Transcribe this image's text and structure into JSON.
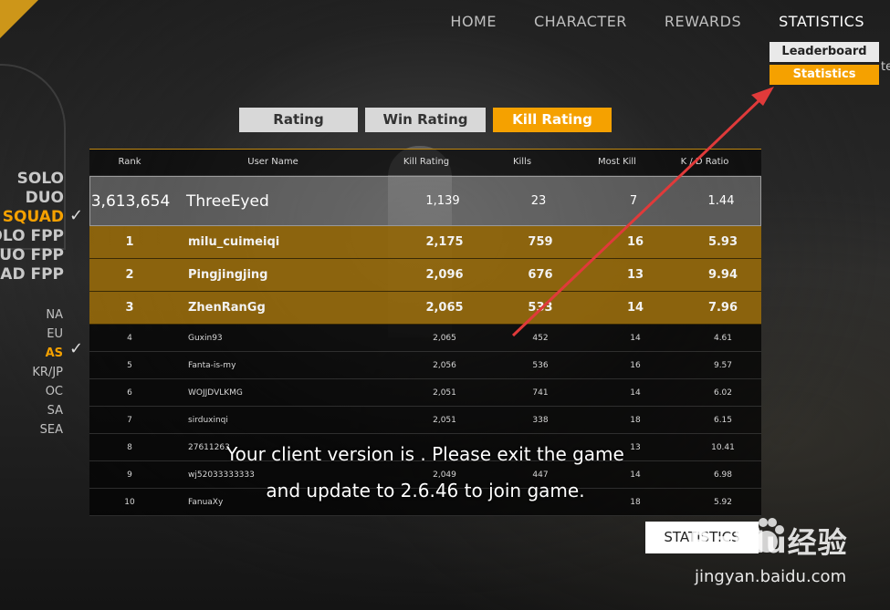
{
  "nav": {
    "items": [
      "HOME",
      "CHARACTER",
      "REWARDS",
      "STATISTICS"
    ],
    "active": "STATISTICS"
  },
  "dropdown": {
    "items": [
      "Leaderboard",
      "Statistics"
    ],
    "active": "Statistics",
    "overflow_text": "te"
  },
  "tabs": {
    "items": [
      "Rating",
      "Win Rating",
      "Kill Rating"
    ],
    "active": "Kill Rating"
  },
  "modes": [
    "SOLO",
    "DUO",
    "SQUAD",
    "SOLO FPP",
    "DUO FPP",
    "SQUAD FPP"
  ],
  "mode_visible": [
    "SOLO",
    "DUO",
    "SQUAD",
    "SOLO FPP",
    "DUO FPP",
    "UAD FPP"
  ],
  "active_mode": "SQUAD",
  "regions": [
    "NA",
    "EU",
    "AS",
    "KR/JP",
    "OC",
    "SA",
    "SEA"
  ],
  "active_region": "AS",
  "table": {
    "headers": [
      "Rank",
      "User Name",
      "Kill Rating",
      "Kills",
      "Most Kill",
      "K / D Ratio"
    ],
    "me": {
      "rank": "3,613,654",
      "name": "ThreeEyed",
      "kill_rating": "1,139",
      "kills": "23",
      "most_kill": "7",
      "kd": "1.44"
    },
    "rows": [
      {
        "rank": "1",
        "name": "milu_cuimeiqi",
        "kill_rating": "2,175",
        "kills": "759",
        "most_kill": "16",
        "kd": "5.93"
      },
      {
        "rank": "2",
        "name": "Pingjingjing",
        "kill_rating": "2,096",
        "kills": "676",
        "most_kill": "13",
        "kd": "9.94"
      },
      {
        "rank": "3",
        "name": "ZhenRanGg",
        "kill_rating": "2,065",
        "kills": "533",
        "most_kill": "14",
        "kd": "7.96"
      },
      {
        "rank": "4",
        "name": "Guxin93",
        "kill_rating": "2,065",
        "kills": "452",
        "most_kill": "14",
        "kd": "4.61"
      },
      {
        "rank": "5",
        "name": "Fanta-is-my",
        "kill_rating": "2,056",
        "kills": "536",
        "most_kill": "16",
        "kd": "9.57"
      },
      {
        "rank": "6",
        "name": "WOJJDVLKMG",
        "kill_rating": "2,051",
        "kills": "741",
        "most_kill": "14",
        "kd": "6.02"
      },
      {
        "rank": "7",
        "name": "sirduxinqi",
        "kill_rating": "2,051",
        "kills": "338",
        "most_kill": "18",
        "kd": "6.15"
      },
      {
        "rank": "8",
        "name": "27611263",
        "kill_rating": "",
        "kills": "",
        "most_kill": "13",
        "kd": "10.41"
      },
      {
        "rank": "9",
        "name": "wj52033333333",
        "kill_rating": "2,049",
        "kills": "447",
        "most_kill": "14",
        "kd": "6.98"
      },
      {
        "rank": "10",
        "name": "FanuaXy",
        "kill_rating": "",
        "kills": "",
        "most_kill": "18",
        "kd": "5.92"
      }
    ]
  },
  "message": {
    "line1": "Your client version is . Please exit the game",
    "line2": "and update to 2.6.46 to join game."
  },
  "statistics_button": "STATISTICS",
  "watermark": {
    "logo": "Baidu经验",
    "url": "jingyan.baidu.com"
  },
  "colors": {
    "accent": "#f5a100",
    "arrow": "#e03a3a",
    "top_row": "#96690a"
  },
  "icons": [
    "check-icon",
    "red-arrow-annotation",
    "baidu-paw-icon"
  ]
}
